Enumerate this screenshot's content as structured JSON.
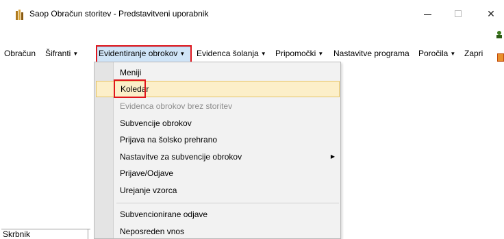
{
  "window": {
    "title": "Saop Obračun storitev - Predstavitveni uporabnik",
    "minimize_glyph": "",
    "maximize_glyph": "",
    "close_glyph": "✕"
  },
  "menubar": {
    "items": [
      {
        "label": "Obračun",
        "has_dropdown": false
      },
      {
        "label": "Šifranti",
        "has_dropdown": true
      },
      {
        "label": "Evidentiranje obrokov",
        "has_dropdown": true,
        "active": true
      },
      {
        "label": "Evidenca šolanja",
        "has_dropdown": true
      },
      {
        "label": "Pripomočki",
        "has_dropdown": true
      },
      {
        "label": "Nastavitve programa",
        "has_dropdown": false
      },
      {
        "label": "Poročila",
        "has_dropdown": true
      },
      {
        "label": "Zapri",
        "has_dropdown": false
      }
    ],
    "dropdown_glyph": "▼"
  },
  "dropdown": {
    "items": [
      {
        "label": "Meniji"
      },
      {
        "label": "Koledar",
        "selected": true
      },
      {
        "label": "Evidenca obrokov brez storitev",
        "disabled": true
      },
      {
        "label": "Subvencije obrokov"
      },
      {
        "label": "Prijava na šolsko prehrano"
      },
      {
        "label": "Nastavitve za subvencije obrokov",
        "submenu": true
      },
      {
        "label": "Prijave/Odjave"
      },
      {
        "label": "Urejanje vzorca"
      },
      {
        "label": "Subvencionirane odjave"
      },
      {
        "label": "Neposreden vnos"
      }
    ],
    "submenu_glyph": "▶"
  },
  "status": {
    "bottom_label": "Skrbnik"
  },
  "colors": {
    "highlight_border": "#e0151b",
    "selected_bg": "#fcefc9",
    "menu_active_bg": "#cfe4f7"
  }
}
